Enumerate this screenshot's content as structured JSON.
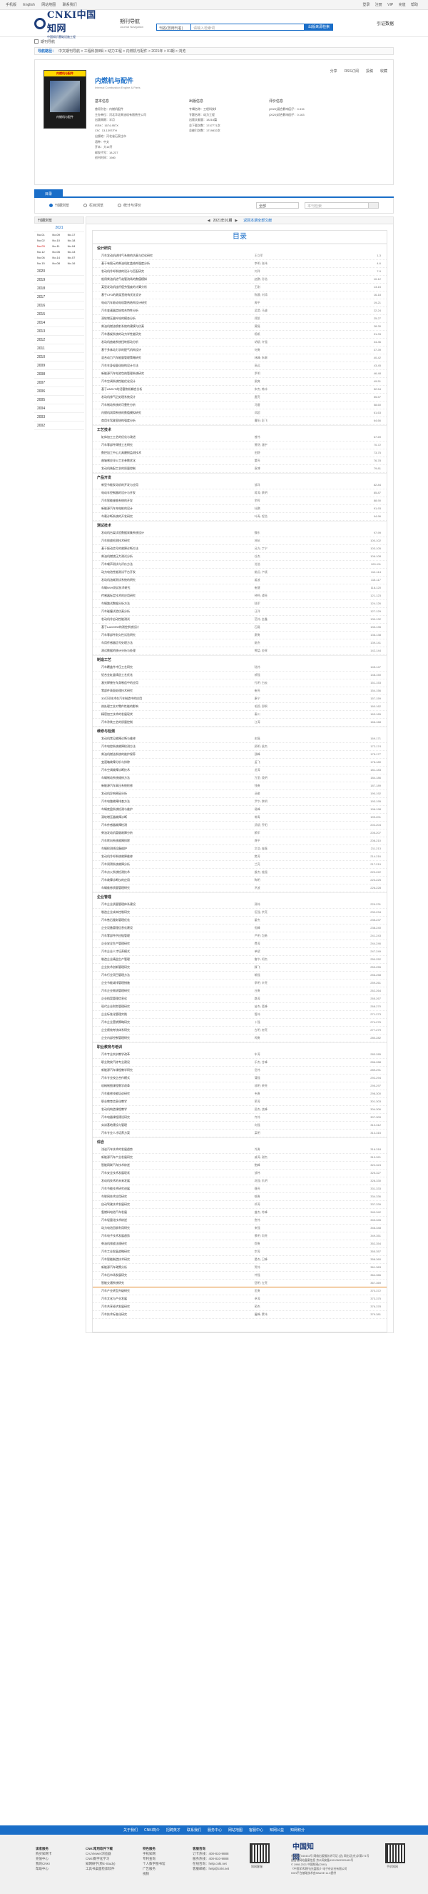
{
  "topbar": {
    "links": [
      "手机版",
      "English",
      "网站地图",
      "联系我们"
    ],
    "right": [
      "登录",
      "注册",
      "VIP",
      "充值",
      "帮助"
    ]
  },
  "header": {
    "logo_text": "CNKI中国知网",
    "logo_sub": "中国知识基础设施工程",
    "nav_label": "期刊导航",
    "nav_sub": "Journal Navigation",
    "search_select": "刊名(曾用刊名)",
    "search_placeholder": "请输入检索词",
    "search_button": "出版来源检索",
    "right_label": "引证数据"
  },
  "breadcrumb": "期刊导航",
  "pathbar": {
    "label": "导航路径：",
    "text": "中文期刊导航 > 工程科技Ⅱ辑 > 动力工程 > 内燃机与配件 > 2021年 > 01期 > 浏览"
  },
  "journal": {
    "cover_bar": "内燃机与配件",
    "cover_caption": "内燃机与配件",
    "title": "内燃机与配件",
    "subtitle": "Internal Combustion Engine & Parts",
    "share": [
      "分享",
      "RSS订阅",
      "投稿",
      "收藏"
    ],
    "basic_head": "基本信息",
    "basic": [
      "曾用刊名：内燃机配件",
      "主办单位：河北华北柴油机有限责任公司",
      "出版周期：半月",
      "ISSN：1674-957X",
      "CN：13-1397/TH",
      "出版地：河北省石家庄市",
      "语种：中文",
      "开本：大16开",
      "邮发代号：18-237",
      "创刊时间：1980"
    ],
    "publish_head": "出版信息",
    "publish": [
      "专辑名称：工程科技Ⅱ",
      "专题名称：动力工程",
      "出版文献量：18216篇",
      "总下载次数：1747771次",
      "总被引次数：1719832次"
    ],
    "eval_head": "评价信息",
    "eval": [
      "(2020)复合影响因子：0.315",
      "(2020)综合影响因子：0.163"
    ]
  },
  "tabs": [
    "目录"
  ],
  "filter": {
    "options": [
      "刊期浏览",
      "栏目浏览",
      "统计与评价"
    ],
    "select": "全部",
    "input_placeholder": "本刊检索"
  },
  "sidebar": {
    "header": "刊期浏览",
    "active_year": "2021",
    "issues": [
      "No.01",
      "No.09",
      "No.17",
      "No.02",
      "No.10",
      "No.18",
      "No.03",
      "No.11",
      "No.04",
      "No.12",
      "No.05",
      "No.13",
      "No.06",
      "No.14",
      "No.07",
      "No.15",
      "No.08",
      "No.16"
    ],
    "red_issue_index": 6,
    "years": [
      "2020",
      "2019",
      "2018",
      "2017",
      "2016",
      "2015",
      "2014",
      "2013",
      "2012",
      "2011",
      "2010",
      "2009",
      "2008",
      "2007",
      "2006",
      "2005",
      "2004",
      "2003",
      "2002"
    ]
  },
  "pager": {
    "prev": "◀",
    "current": "2021年01期",
    "next": "▶",
    "extra": "返回本期全部文献"
  },
  "toc": {
    "title": "目录",
    "sections": [
      {
        "name": "设计研究",
        "entries": [
          [
            "汽车发动机进排气系统的仿真与优化研究",
            "王立军",
            "1-3"
          ],
          [
            "基于有限元的柴油机缸盖结构强度分析",
            "李明; 张伟",
            "4-6"
          ],
          [
            "发动机冷却系统的设计与匹配研究",
            "刘洋",
            "7-9"
          ],
          [
            "船用柴油机进气歧管流场的数值模拟",
            "赵鹏; 孙浩",
            "10-12"
          ],
          [
            "某型发动机连杆疲劳强度的计算分析",
            "王刚",
            "13-15"
          ],
          [
            "基于CFD的燃烧室结构优化设计",
            "陈晨; 刘涛",
            "16-18"
          ],
          [
            "电动汽车驱动电机散热结构设计研究",
            "周平",
            "19-21"
          ],
          [
            "汽车变速器齿轮啮合特性分析",
            "吴昊; 马骏",
            "22-24"
          ],
          [
            "涡轮增压器叶轮的模态分析",
            "郑凯",
            "25-27"
          ],
          [
            "柴油机燃油喷射系统的建模与仿真",
            "黄磊",
            "28-30"
          ],
          [
            "汽车悬架系统的动力学性能研究",
            "杨帆",
            "31-33"
          ],
          [
            "发动机曲轴系统扭转振动分析",
            "胡斌; 许强",
            "34-36"
          ],
          [
            "基于多体动力学的配气机构设计",
            "何勇",
            "37-39"
          ],
          [
            "混合动力汽车能量管理策略研究",
            "林峰; 朱琳",
            "40-42"
          ],
          [
            "汽车车身轻量化结构设计方法",
            "高远",
            "43-45"
          ],
          [
            "新能源汽车电池包热管理系统研究",
            "罗明",
            "46-48"
          ],
          [
            "汽车空调系统性能优化设计",
            "梁爽",
            "49-51"
          ],
          [
            "基于ANSYS的活塞热机耦合分析",
            "宋杰; 韩冰",
            "52-54"
          ],
          [
            "发动机排气后处理系统设计",
            "唐亮",
            "55-57"
          ],
          [
            "汽车制动系统的可靠性分析",
            "冯雷",
            "58-60"
          ],
          [
            "内燃机润滑系统的数值模拟研究",
            "邓超",
            "61-63"
          ],
          [
            "商用车驾驶室结构强度分析",
            "曹阳; 彭飞",
            "64-66"
          ]
        ]
      },
      {
        "name": "工艺技术",
        "entries": [
          [
            "缸体加工工艺的优化与改进",
            "曾伟",
            "67-69"
          ],
          [
            "汽车零部件焊接工艺研究",
            "萧然; 潘宇",
            "70-72"
          ],
          [
            "数控加工中心刀具磨损监测技术",
            "田野",
            "73-75"
          ],
          [
            "曲轴感应淬火工艺参数优化",
            "董亮",
            "76-78"
          ],
          [
            "发动机装配工艺的质量控制",
            "袁博",
            "79-81"
          ]
        ]
      },
      {
        "name": "产品开发",
        "entries": [
          [
            "新型节能发动机的开发与应用",
            "邹洋",
            "82-84"
          ],
          [
            "电动车控制器的设计与开发",
            "蒋涛; 蔡明",
            "85-87"
          ],
          [
            "汽车智能座舱系统的开发",
            "余晖",
            "88-90"
          ],
          [
            "新能源汽车充电桩的设计",
            "杜鹏",
            "91-93"
          ],
          [
            "车载诊断系统的开发研究",
            "叶青; 程浩",
            "94-96"
          ]
        ]
      },
      {
        "name": "测试技术",
        "entries": [
          [
            "发动机台架试验数据采集系统设计",
            "魏东",
            "97-99"
          ],
          [
            "汽车排放检测技术研究",
            "苏杭",
            "100-102"
          ],
          [
            "基于振动信号的故障诊断方法",
            "吕方; 丁宁",
            "103-105"
          ],
          [
            "柴油机燃烧压力测试分析",
            "任杰",
            "106-108"
          ],
          [
            "汽车噪声测试与评价方法",
            "沈浩",
            "109-111"
          ],
          [
            "动力电池性能测试平台开发",
            "姚远; 卢斌",
            "112-114"
          ],
          [
            "发动机油耗测试系统的研究",
            "姜波",
            "115-117"
          ],
          [
            "车辆NVH测试技术研究",
            "崔健",
            "118-120"
          ],
          [
            "传感器标定技术的应用研究",
            "钟鸣; 谭亮",
            "121-123"
          ],
          [
            "车辆路试数据分析方法",
            "陆军",
            "124-126"
          ],
          [
            "汽车碰撞试验仿真分析",
            "汪洋",
            "127-129"
          ],
          [
            "发动机冷启动性能测试",
            "范伟; 金鑫",
            "130-132"
          ],
          [
            "基于LabVIEW的测控系统设计",
            "石磊",
            "133-135"
          ],
          [
            "汽车零部件耐久性试验研究",
            "廖勇",
            "136-138"
          ],
          [
            "车用传感器信号处理方法",
            "姚杰",
            "139-141"
          ],
          [
            "测试数据的统计分析与处理",
            "熊猛; 金辉",
            "142-144"
          ]
        ]
      },
      {
        "name": "制造工艺",
        "entries": [
          [
            "汽车覆盖件冲压工艺研究",
            "陆伟",
            "145-147"
          ],
          [
            "铝合金缸盖铸造工艺优化",
            "郝强",
            "148-150"
          ],
          [
            "激光焊接在车身制造中的应用",
            "孔明; 白云",
            "151-153"
          ],
          [
            "零部件表面处理技术研究",
            "崔亮",
            "154-156"
          ],
          [
            "3D打印技术在汽车制造中的应用",
            "康宁",
            "157-159"
          ],
          [
            "热处理工艺对零件性能的影响",
            "毛毅; 邱枫",
            "160-162"
          ],
          [
            "精密加工技术的发展现状",
            "秦川",
            "163-165"
          ],
          [
            "汽车涂装工艺的质量控制",
            "江涛",
            "166-168"
          ]
        ]
      },
      {
        "name": "维修与检测",
        "entries": [
          [
            "发动机常见故障诊断与维修",
            "史磊",
            "169-171"
          ],
          [
            "汽车电控系统故障检测方法",
            "顾明; 侯杰",
            "172-174"
          ],
          [
            "柴油机燃油系统的维护保养",
            "邵峰",
            "175-177"
          ],
          [
            "变速箱故障分析与排除",
            "孟飞",
            "178-180"
          ],
          [
            "汽车空调故障诊断技术",
            "龙涛",
            "181-183"
          ],
          [
            "车辆制动系统维修方法",
            "万里; 段明",
            "184-186"
          ],
          [
            "新能源汽车高压系统检修",
            "钱勇",
            "187-189"
          ],
          [
            "发动机异响原因分析",
            "汤俊",
            "190-192"
          ],
          [
            "汽车电路故障排查方法",
            "尹华; 黎明",
            "193-195"
          ],
          [
            "车辆底盘系统检测与维护",
            "易峰",
            "196-198"
          ],
          [
            "涡轮增压器故障诊断",
            "常青",
            "199-201"
          ],
          [
            "汽车传感器故障检测",
            "武斌; 乔阳",
            "202-204"
          ],
          [
            "柴油发动机冒烟故障分析",
            "赖军",
            "205-207"
          ],
          [
            "汽车转向系统故障排除",
            "龚平",
            "208-210"
          ],
          [
            "车辆检测线设备维护",
            "文浩; 庞磊",
            "211-213"
          ],
          [
            "发动机冷却系统故障维修",
            "樊涛",
            "214-216"
          ],
          [
            "汽车润滑系统故障分析",
            "兰亮",
            "217-219"
          ],
          [
            "汽车点火系统检测技术",
            "殷杰; 施强",
            "220-222"
          ],
          [
            "汽车故障诊断仪的应用",
            "陶明",
            "223-225"
          ],
          [
            "车辆维修质量管理研究",
            "洪波",
            "226-228"
          ]
        ]
      },
      {
        "name": "企业管理",
        "entries": [
          [
            "汽车企业质量管理体系建设",
            "邢伟",
            "229-231"
          ],
          [
            "制造企业成本控制研究",
            "伍强; 余亮",
            "232-234"
          ],
          [
            "汽车售后服务管理优化",
            "翟杰",
            "235-237"
          ],
          [
            "企业设备管理信息化建设",
            "倪峰",
            "238-240"
          ],
          [
            "汽车零部件供应链管理",
            "严明; 包勇",
            "241-243"
          ],
          [
            "企业安全生产管理研究",
            "费涛",
            "244-246"
          ],
          [
            "汽车企业人才培养模式",
            "单斌",
            "247-249"
          ],
          [
            "制造企业精益生产管理",
            "鲁华; 柯杰",
            "250-252"
          ],
          [
            "企业技术创新管理研究",
            "滕飞",
            "253-255"
          ],
          [
            "汽车行业项目管理方法",
            "喻强",
            "256-258"
          ],
          [
            "企业节能减排管理措施",
            "季明; 辛亮",
            "259-261"
          ],
          [
            "汽车企业物流管理研究",
            "谷勇",
            "262-264"
          ],
          [
            "企业档案管理信息化",
            "路涛",
            "265-267"
          ],
          [
            "现代企业财务管理研究",
            "苗杰; 葛峰",
            "268-270"
          ],
          [
            "企业标准化管理实践",
            "管伟",
            "271-273"
          ],
          [
            "汽车企业营销策略研究",
            "卜强",
            "274-276"
          ],
          [
            "企业绩效考核体系研究",
            "古明; 房亮",
            "277-279"
          ],
          [
            "企业内部控制管理研究",
            "闻勇",
            "280-282"
          ]
        ]
      },
      {
        "name": "职业教育与培训",
        "entries": [
          [
            "汽车专业实训教学改革",
            "车涛",
            "283-285"
          ],
          [
            "职业院校汽修专业建设",
            "乐杰; 甘峰",
            "286-288"
          ],
          [
            "新能源汽车课程教学研究",
            "岳伟",
            "289-291"
          ],
          [
            "汽车专业校企合作模式",
            "蒲强",
            "292-294"
          ],
          [
            "机械制图课程教学改革",
            "邬明; 柴亮",
            "295-297"
          ],
          [
            "汽车维修技能培训研究",
            "韦勇",
            "298-300"
          ],
          [
            "职业教育信息化教学",
            "荣涛",
            "301-303"
          ],
          [
            "发动机构造课程教学",
            "屈杰; 饶峰",
            "304-306"
          ],
          [
            "汽车电器课程建设研究",
            "齐伟",
            "307-309"
          ],
          [
            "实训基地建设与管理",
            "向强",
            "310-312"
          ],
          [
            "汽车专业人才培养方案",
            "栾明",
            "313-315"
          ]
        ]
      },
      {
        "name": "综合",
        "entries": [
          [
            "浅谈汽车技术的发展趋势",
            "冷勇",
            "316-318"
          ],
          [
            "新能源汽车产业发展研究",
            "戚涛; 谢杰",
            "319-321"
          ],
          [
            "智能网联汽车技术综述",
            "鲍峰",
            "322-324"
          ],
          [
            "汽车安全技术发展现状",
            "邹伟",
            "325-327"
          ],
          [
            "发动机技术的未来发展",
            "巩强; 仇明",
            "328-330"
          ],
          [
            "汽车节能技术研究进展",
            "聂亮",
            "331-333"
          ],
          [
            "车联网技术应用研究",
            "郁勇",
            "334-336"
          ],
          [
            "自动驾驶技术发展研究",
            "祁涛",
            "337-339"
          ],
          [
            "氢燃料电池汽车发展",
            "盛杰; 符峰",
            "340-342"
          ],
          [
            "汽车轻量化技术综述",
            "詹伟",
            "343-345"
          ],
          [
            "动力电池回收利用研究",
            "束强",
            "346-348"
          ],
          [
            "汽车电子技术发展趋势",
            "景明; 尚亮",
            "349-351"
          ],
          [
            "柴油机排放法规研究",
            "缪勇",
            "352-354"
          ],
          [
            "汽车工业发展战略研究",
            "宗涛",
            "355-357"
          ],
          [
            "汽车智能制造技术研究",
            "晏杰; 卫峰",
            "358-360"
          ],
          [
            "新能源汽车政策分析",
            "贺伟",
            "361-363"
          ],
          [
            "汽车后市场发展研究",
            "仲强",
            "364-366"
          ],
          [
            "智能交通系统研究",
            "钮明; 左亮",
            "367-369"
          ],
          [
            "汽车产业转型升级研究",
            "匡勇",
            "370-372"
          ],
          [
            "汽车文化与产业发展",
            "卓涛",
            "373-375"
          ],
          [
            "汽车共享经济发展研究",
            "蔺杰",
            "376-378"
          ],
          [
            "汽车技术标准化研究",
            "屠峰; 蒙伟",
            "379-381"
          ]
        ]
      }
    ]
  },
  "footbar": [
    "关于我们",
    "CNKI简介",
    "招聘英才",
    "联系我们",
    "服务中心",
    "网站地图",
    "客服中心",
    "知网公益",
    "知网积分"
  ],
  "footer": {
    "col1": [
      "读者服务",
      "购买知网卡",
      "充值中心",
      "我的CNKI",
      "帮助中心"
    ],
    "col2": [
      "CNKI常用软件下载",
      "CAJViewer浏览器",
      "CNKI数字化学习",
      "知网研学(原E-Study)",
      "工具书桌面检索软件"
    ],
    "col3": [
      "特色服务",
      "手机知网",
      "专利查询",
      "个人数字图书馆",
      "广告服务",
      "视频"
    ],
    "col4": [
      "客服咨询",
      "订卡热线：400-810-9888",
      "服务热线：400-810-9888",
      "在线咨询：help.cnki.net",
      "客服邮箱：help@cnki.net"
    ],
    "logo": "中国知网",
    "info": [
      "京ICP证040431号 网络出版服务许可证 (总) 网出证(京)字第271号",
      "经营性网站备案信息 京公网安备11010802020460号",
      "© 1998-2021 中国知网(CNKI)",
      "《中国学术期刊(光盘版)》电子杂志社有限公司",
      "KDN平台基础技术由KBASE 11.0提供"
    ],
    "qr1": "知网客服",
    "qr2": "手机知网"
  }
}
